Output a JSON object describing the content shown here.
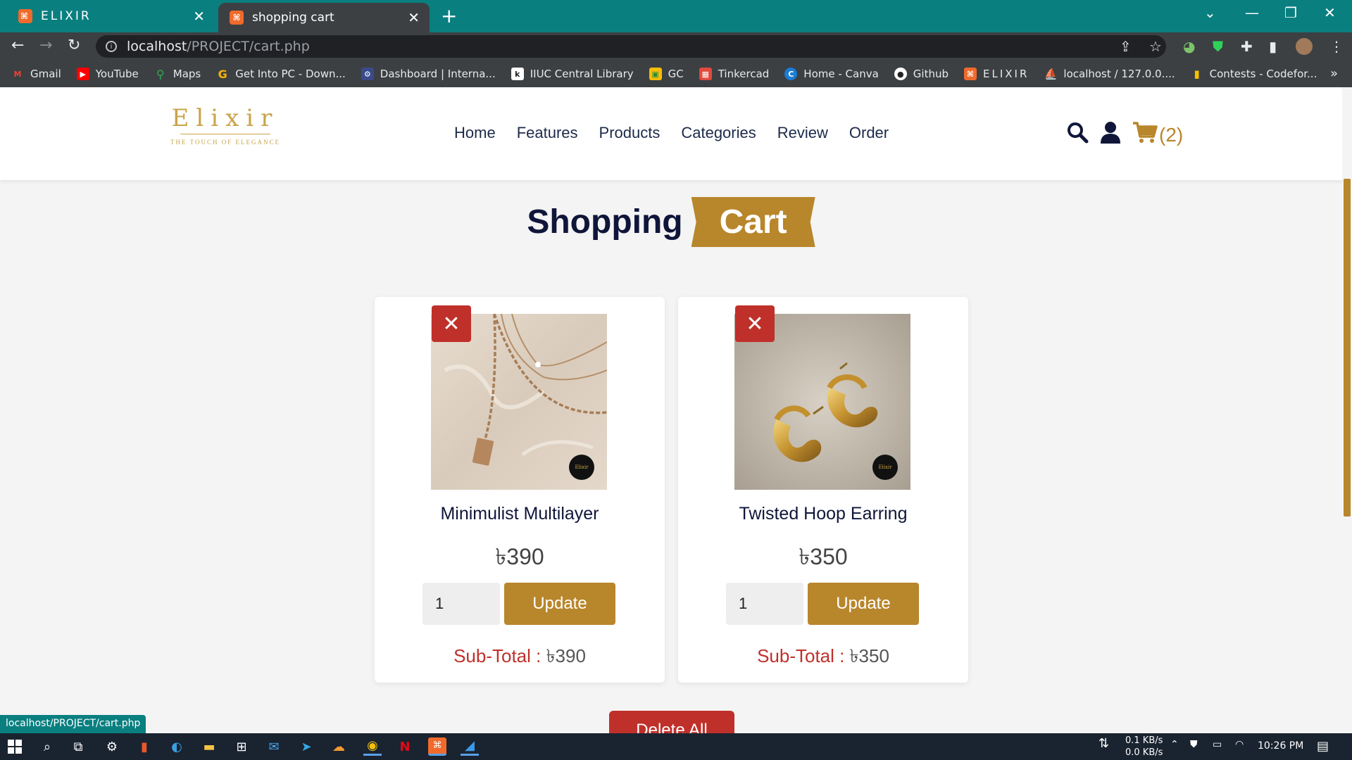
{
  "browser": {
    "tabs": [
      {
        "title": "ELIXIR"
      },
      {
        "title": "shopping cart"
      }
    ],
    "address": {
      "host": "localhost",
      "path": "/PROJECT/cart.php"
    },
    "bookmarks": [
      {
        "label": "Gmail",
        "icon": "gmail-icon",
        "color": "#ea4335"
      },
      {
        "label": "YouTube",
        "icon": "youtube-icon",
        "color": "#ff0000"
      },
      {
        "label": "Maps",
        "icon": "maps-icon",
        "color": "#34a853"
      },
      {
        "label": "Get Into PC - Down...",
        "icon": "getintopc-icon",
        "color": "#f5b400"
      },
      {
        "label": "Dashboard | Interna...",
        "icon": "dashboard-icon",
        "color": "#3a4a8a"
      },
      {
        "label": "IIUC Central Library",
        "icon": "library-icon",
        "color": "#ffffff"
      },
      {
        "label": "GC",
        "icon": "classroom-icon",
        "color": "#fbbc04"
      },
      {
        "label": "Tinkercad",
        "icon": "tinkercad-icon",
        "color": "#e04a3c"
      },
      {
        "label": "Home - Canva",
        "icon": "canva-icon",
        "color": "#1a7cd6"
      },
      {
        "label": "Github",
        "icon": "github-icon",
        "color": "#ffffff"
      },
      {
        "label": "ELIXIR",
        "icon": "xampp-icon",
        "color": "#f06a2c"
      },
      {
        "label": "localhost / 127.0.0....",
        "icon": "phpmyadmin-icon",
        "color": "#f5a623"
      },
      {
        "label": "Contests - Codefor...",
        "icon": "codeforces-icon",
        "color": "#f5c000"
      }
    ],
    "status_url": "localhost/PROJECT/cart.php"
  },
  "site": {
    "logo": {
      "word": "Elixir",
      "tagline": "THE TOUCH OF ELEGANCE"
    },
    "nav": [
      "Home",
      "Features",
      "Products",
      "Categories",
      "Review",
      "Order"
    ],
    "cart_count": "(2)",
    "heading": {
      "part1": "Shopping",
      "part2": "Cart"
    },
    "items": [
      {
        "name": "Minimulist Multilayer",
        "price": "৳390",
        "qty": "1",
        "update_label": "Update",
        "subtotal_label": "Sub-Total :",
        "subtotal_value": "৳390",
        "badge": "Elixir"
      },
      {
        "name": "Twisted Hoop Earring",
        "price": "৳350",
        "qty": "1",
        "update_label": "Update",
        "subtotal_label": "Sub-Total :",
        "subtotal_value": "৳350",
        "badge": "Elixir"
      }
    ],
    "delete_all_label": "Delete All"
  },
  "taskbar": {
    "net_down": "0.1 KB/s",
    "net_up": "0.0 KB/s",
    "time": "10:26 PM"
  },
  "colors": {
    "accent": "#b8862b",
    "danger": "#c0302a",
    "navy": "#10163a",
    "tabbar": "#0a7f80"
  }
}
